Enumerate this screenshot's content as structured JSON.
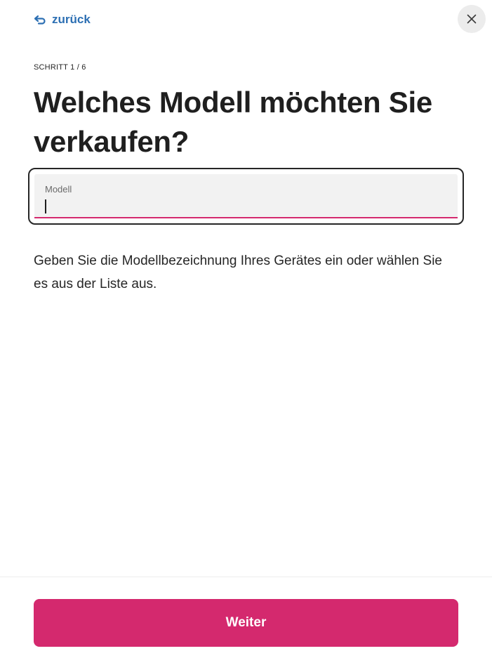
{
  "header": {
    "back_label": "zurück",
    "back_icon": "back-arrow-icon",
    "close_icon": "close-icon"
  },
  "step": {
    "label": "SCHRITT 1 / 6"
  },
  "main": {
    "title": "Welches Modell möchten Sie verkaufen?",
    "model_field": {
      "label": "Modell",
      "value": "",
      "placeholder": ""
    },
    "help_text": "Geben Sie die Modellbezeichnung Ihres Gerätes ein oder wählen Sie es aus der Liste aus."
  },
  "footer": {
    "next_label": "Weiter"
  },
  "colors": {
    "accent": "#d4296e",
    "link": "#2c6fb3",
    "text": "#1f1f1f",
    "field_background": "#f2f2f2",
    "close_background": "#ececec"
  }
}
